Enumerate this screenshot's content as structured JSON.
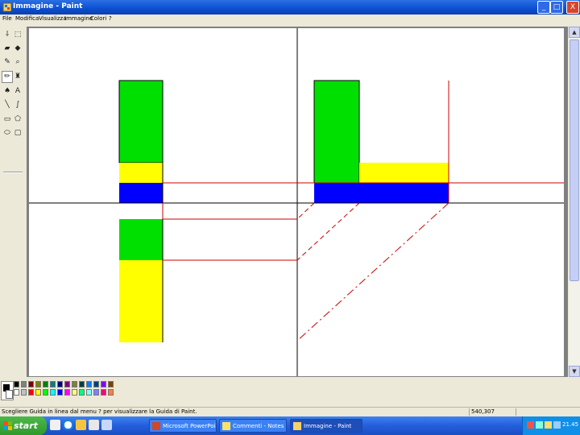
{
  "window": {
    "title": "Immagine - Paint",
    "min_label": "_",
    "max_label": "□",
    "close_label": "X"
  },
  "menu": {
    "items": [
      "File",
      "Modifica",
      "Visualizza",
      "Immagine",
      "Colori",
      "?"
    ]
  },
  "palette": {
    "fg": "#000000",
    "bg": "#ffffff",
    "colors": [
      "#000000",
      "#808080",
      "#800000",
      "#808000",
      "#008000",
      "#008080",
      "#000080",
      "#800080",
      "#808040",
      "#004040",
      "#0080ff",
      "#004080",
      "#8000ff",
      "#804000",
      "#ffffff",
      "#c0c0c0",
      "#ff0000",
      "#ffff00",
      "#00ff00",
      "#00ffff",
      "#0000ff",
      "#ff00ff",
      "#ffff80",
      "#00ff80",
      "#80ffff",
      "#8080ff",
      "#ff0080",
      "#ff8040"
    ]
  },
  "status": {
    "text": "Scegliere Guida in linea dal menu ? per visualizzare la Guida di Paint.",
    "coords": "540,307"
  },
  "taskbar": {
    "start": "start",
    "tasks": [
      "Microsoft PowerPoint - ...",
      "Commenti - Notes ...",
      "Immagine - Paint"
    ],
    "clock": "21.45"
  },
  "colors": {
    "green": "#00e000",
    "yellow": "#ffff00",
    "blue": "#0000ff",
    "construction_line": "#cc0000",
    "axis": "#000000"
  }
}
